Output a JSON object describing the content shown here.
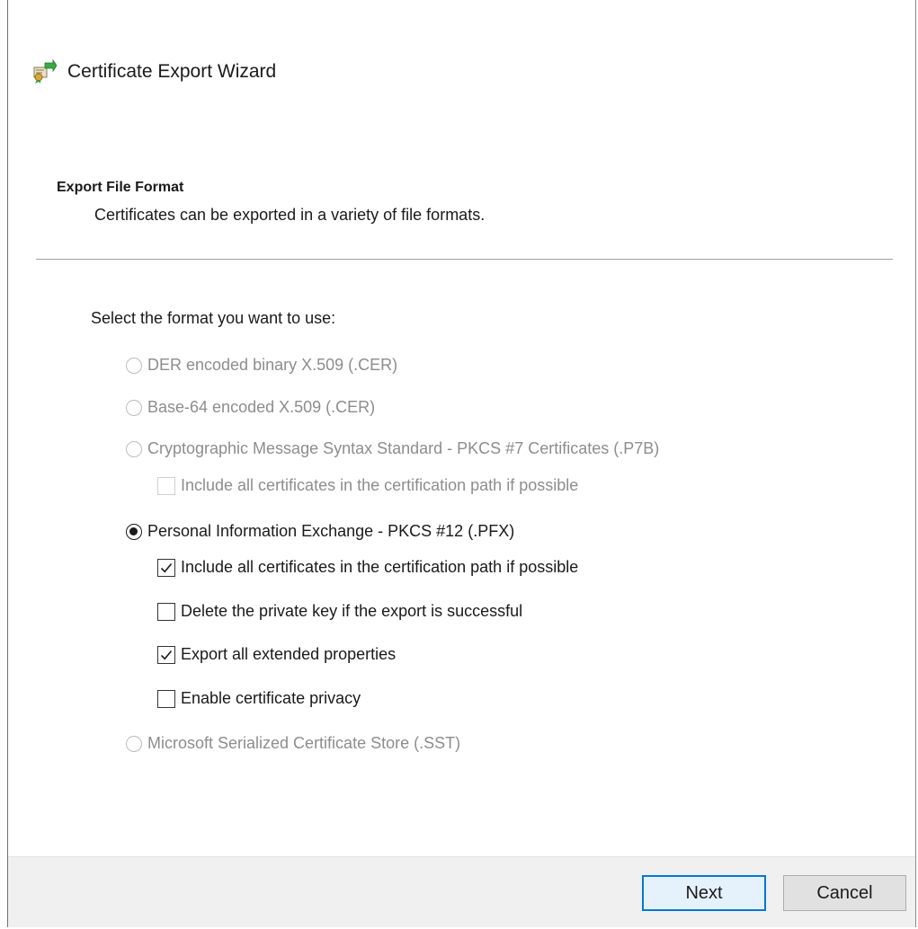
{
  "window": {
    "title": "Certificate Export Wizard",
    "icon": "certificate-export-icon"
  },
  "header": {
    "heading": "Export File Format",
    "description": "Certificates can be exported in a variety of file formats."
  },
  "form": {
    "prompt": "Select the format you want to use:",
    "options": [
      {
        "label": "DER encoded binary X.509 (.CER)",
        "selected": false,
        "enabled": false
      },
      {
        "label": "Base-64 encoded X.509 (.CER)",
        "selected": false,
        "enabled": false
      },
      {
        "label": "Cryptographic Message Syntax Standard - PKCS #7 Certificates (.P7B)",
        "selected": false,
        "enabled": false
      },
      {
        "label": "Personal Information Exchange - PKCS #12 (.PFX)",
        "selected": true,
        "enabled": true
      },
      {
        "label": "Microsoft Serialized Certificate Store (.SST)",
        "selected": false,
        "enabled": false
      }
    ],
    "p7b_include_all": {
      "label": "Include all certificates in the certification path if possible",
      "checked": false,
      "enabled": false
    },
    "pfx_include_all": {
      "label": "Include all certificates in the certification path if possible",
      "checked": true,
      "enabled": true
    },
    "pfx_delete_key": {
      "label": "Delete the private key if the export is successful",
      "checked": false,
      "enabled": true
    },
    "pfx_export_ext": {
      "label": "Export all extended properties",
      "checked": true,
      "enabled": true
    },
    "pfx_privacy": {
      "label": "Enable certificate privacy",
      "checked": false,
      "enabled": true
    }
  },
  "footer": {
    "next_label": "Next",
    "cancel_label": "Cancel"
  },
  "colors": {
    "accent": "#0078d7",
    "disabled_text": "#8d8d8d",
    "footer_bg": "#f0f0f0"
  }
}
